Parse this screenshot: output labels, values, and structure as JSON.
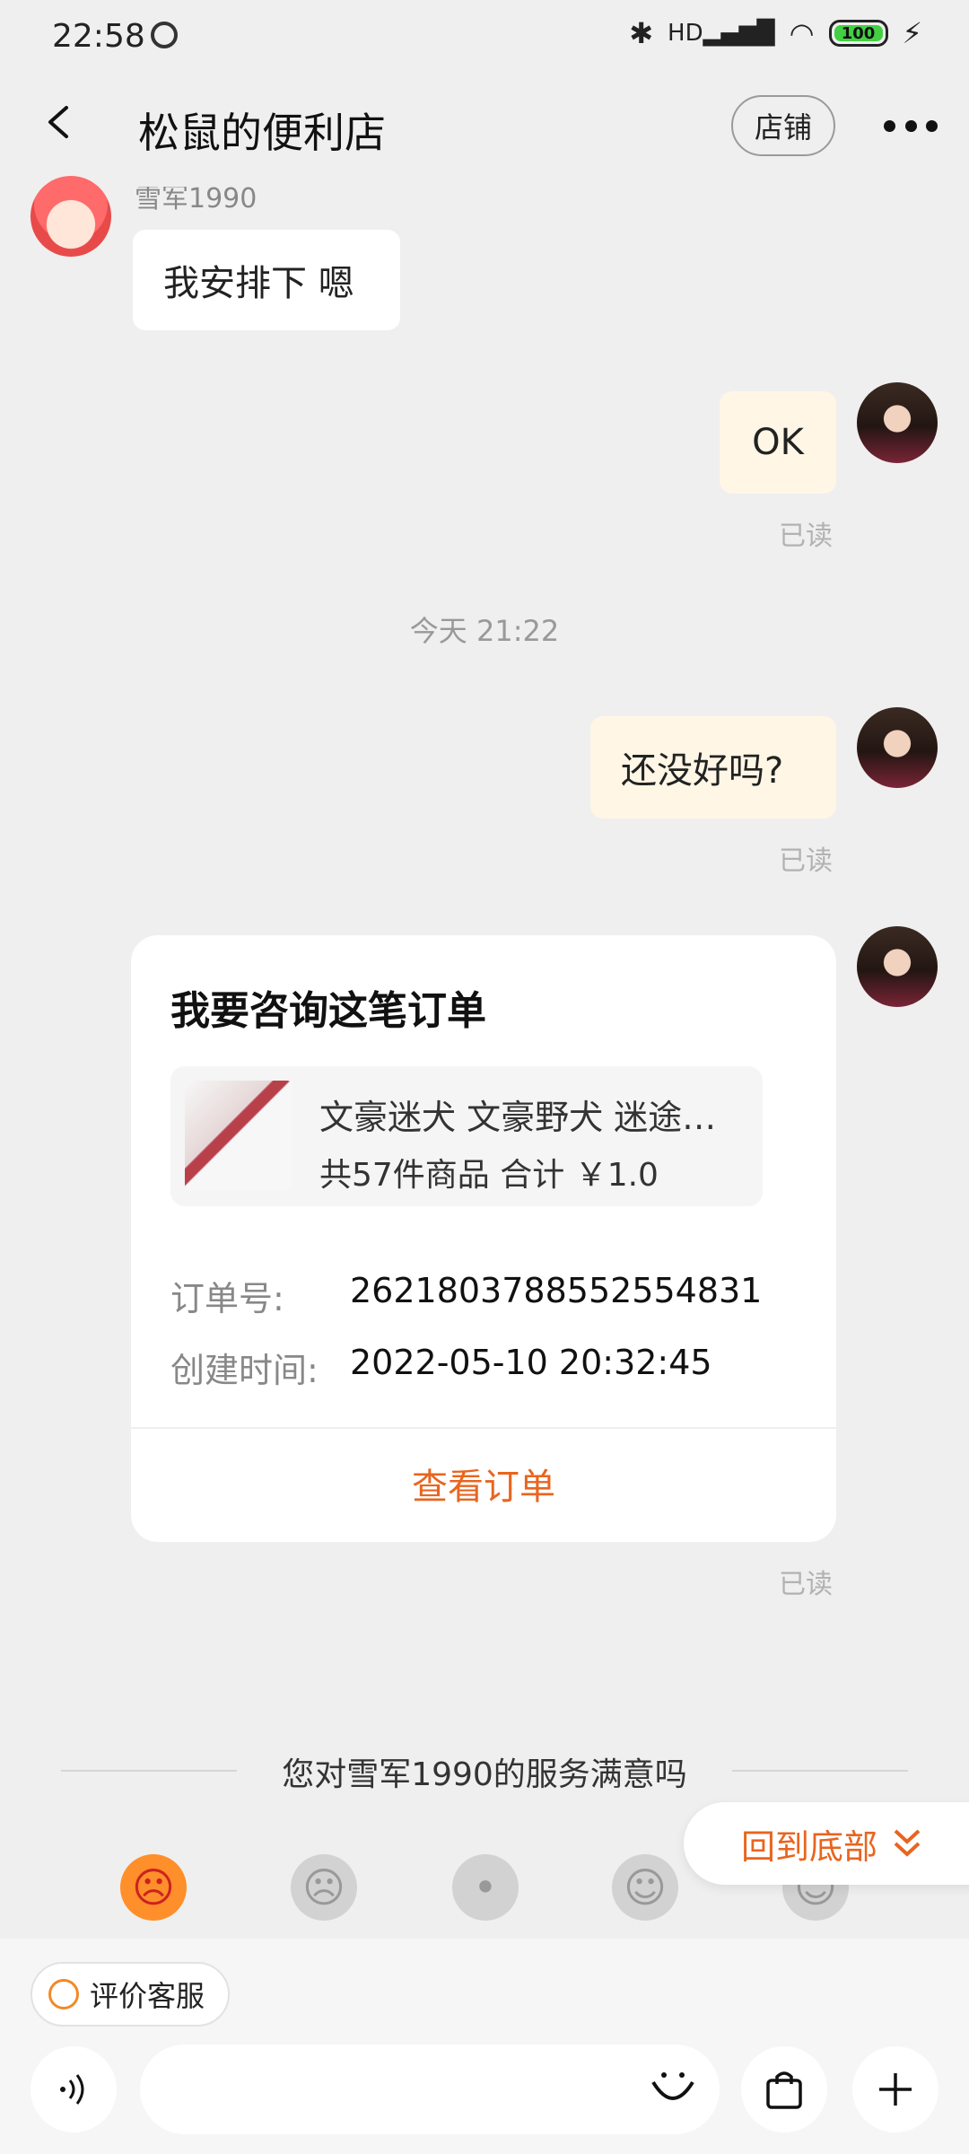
{
  "status": {
    "time": "22:58",
    "battery": "100",
    "signal_label": "HD"
  },
  "header": {
    "title": "松鼠的便利店",
    "shop_button": "店铺"
  },
  "messages": {
    "sender_name": "雪军1990",
    "msg1": "我安排下 嗯",
    "msg2": "OK",
    "read1": "已读",
    "timestamp": "今天  21:22",
    "msg3": "还没好吗?",
    "read2": "已读",
    "read3": "已读"
  },
  "order_card": {
    "title": "我要咨询这笔订单",
    "product_name": "文豪迷犬 文豪野犬 迷途…",
    "product_summary": "共57件商品  合计 ￥1.0",
    "order_no_label": "订单号:",
    "order_no": "2621803788552554831",
    "created_label": "创建时间:",
    "created_time": "2022-05-10 20:32:45",
    "view_order": "查看订单"
  },
  "rating": {
    "question": "您对雪军1990的服务满意吗",
    "faces": [
      "angry-face-icon",
      "sad-face-icon",
      "neutral-face-icon",
      "smile-face-icon",
      "laugh-face-icon"
    ],
    "back_to_bottom": "回到底部"
  },
  "bottom": {
    "rate_service": "评价客服"
  },
  "colors": {
    "accent": "#e8651f",
    "cream_bubble": "#fff6e6",
    "background": "#efefef"
  }
}
